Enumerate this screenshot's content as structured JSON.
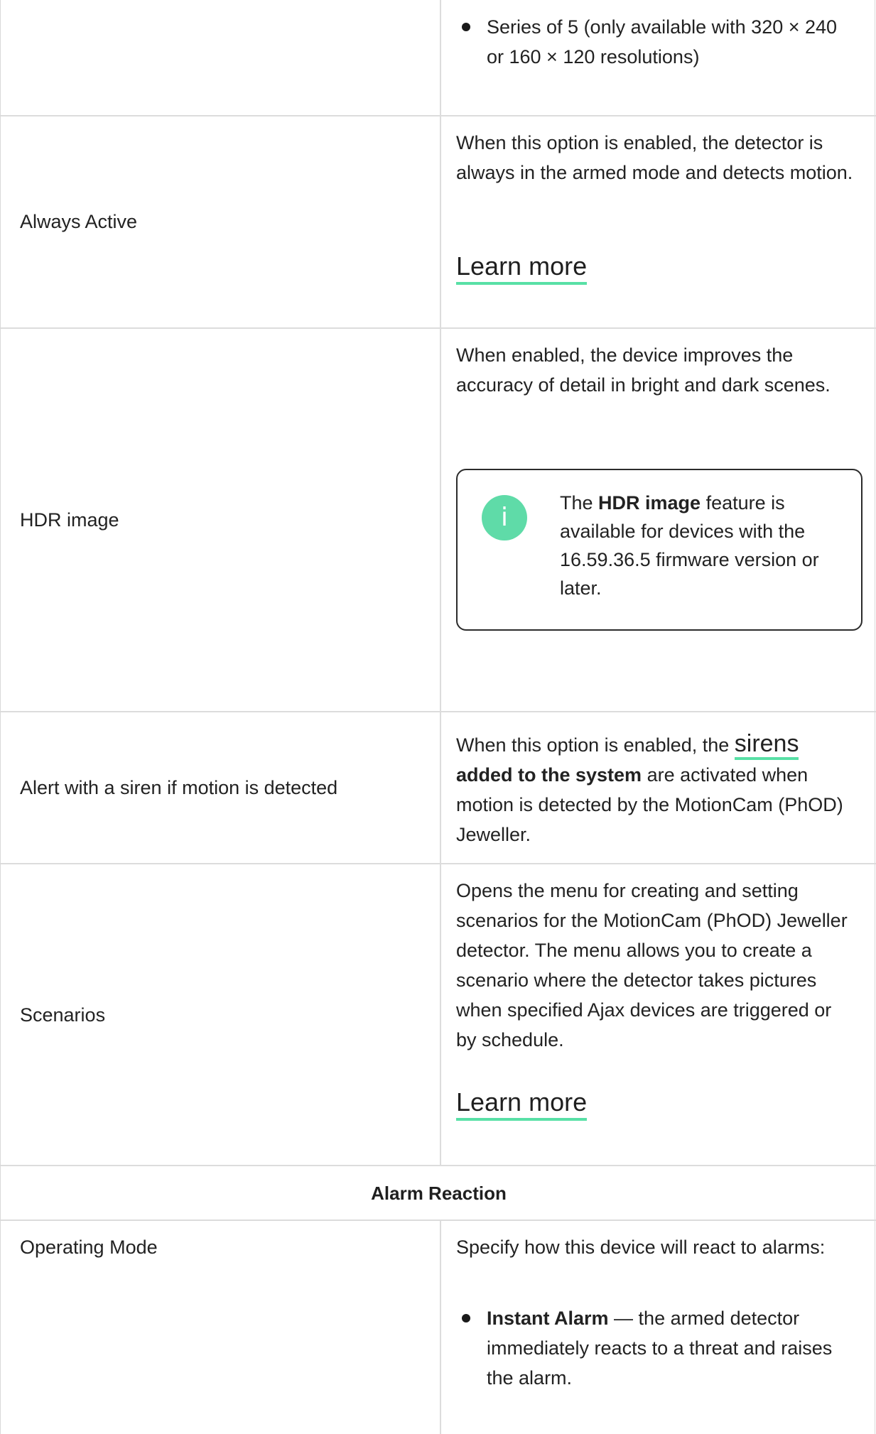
{
  "rows": {
    "top_bullet": "Series of 5 (only available with 320 × 240 or 160 × 120 resolutions)",
    "always_active": {
      "label": "Always Active",
      "description": "When this option is enabled, the detector is always in the armed mode and detects motion.",
      "link": "Learn more"
    },
    "hdr": {
      "label": "HDR image",
      "description": "When enabled, the device improves the accuracy of detail in bright and dark scenes.",
      "note_prefix": "The ",
      "note_bold": "HDR image",
      "note_suffix": " feature is available for devices with the 16.59.36.5 firmware version or later.",
      "note_icon": "i"
    },
    "siren": {
      "label": "Alert with a siren if motion is detected",
      "description_prefix": "When this option is enabled, the ",
      "link": "sirens",
      "bold": "added to the system",
      "description_suffix": " are activated when motion is detected by the MotionCam (PhOD) Jeweller."
    },
    "scenarios": {
      "label": "Scenarios",
      "description": "Opens the menu for creating and setting scenarios for the MotionCam (PhOD) Jeweller detector. The menu allows you to create a scenario where the detector takes pictures when specified Ajax devices are triggered or by schedule.",
      "link": "Learn more"
    },
    "section_title": "Alarm Reaction",
    "operating_mode": {
      "label": "Operating Mode",
      "description": "Specify how this device will react to alarms:",
      "bullet_bold": "Instant Alarm",
      "bullet_text": " — the armed detector immediately reacts to a threat and raises the alarm."
    }
  },
  "colors": {
    "accent": "#58e0a6",
    "border": "#dcdcdc",
    "text": "#222222"
  }
}
